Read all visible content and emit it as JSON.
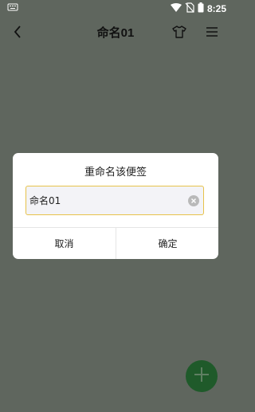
{
  "status_bar": {
    "time": "8:25"
  },
  "app_bar": {
    "title": "命名01"
  },
  "dialog": {
    "title": "重命名该便签",
    "input_value": "命名01",
    "cancel_label": "取消",
    "confirm_label": "确定"
  },
  "colors": {
    "scrim": "#5f665e",
    "fab": "#1f5a2a",
    "input_border": "#e7c24a"
  }
}
